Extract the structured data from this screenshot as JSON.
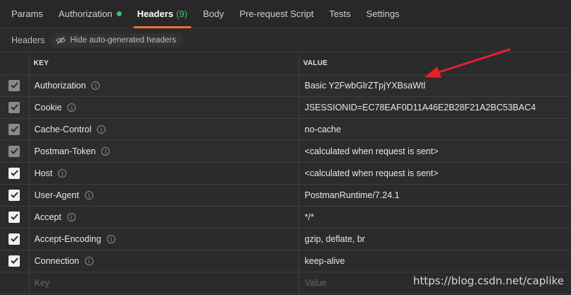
{
  "tabs": [
    {
      "label": "Params"
    },
    {
      "label": "Authorization"
    },
    {
      "label": "Headers",
      "count": "(9)"
    },
    {
      "label": "Body"
    },
    {
      "label": "Pre-request Script"
    },
    {
      "label": "Tests"
    },
    {
      "label": "Settings"
    }
  ],
  "subbar": {
    "label": "Headers",
    "hide_button": "Hide auto-generated headers"
  },
  "table": {
    "columns": {
      "key": "KEY",
      "value": "VALUE"
    },
    "rows": [
      {
        "key": "Authorization",
        "value": "Basic Y2FwbGlrZTpjYXBsaWtl",
        "auto": true
      },
      {
        "key": "Cookie",
        "value": "JSESSIONID=EC78EAF0D11A46E2B28F21A2BC53BAC4",
        "auto": true
      },
      {
        "key": "Cache-Control",
        "value": "no-cache",
        "auto": true
      },
      {
        "key": "Postman-Token",
        "value": "<calculated when request is sent>",
        "auto": true
      },
      {
        "key": "Host",
        "value": "<calculated when request is sent>",
        "auto": false
      },
      {
        "key": "User-Agent",
        "value": "PostmanRuntime/7.24.1",
        "auto": false
      },
      {
        "key": "Accept",
        "value": "*/*",
        "auto": false
      },
      {
        "key": "Accept-Encoding",
        "value": "gzip, deflate, br",
        "auto": false
      },
      {
        "key": "Connection",
        "value": "keep-alive",
        "auto": false
      }
    ],
    "new_row": {
      "key_placeholder": "Key",
      "value_placeholder": "Value"
    }
  },
  "watermark": "https://blog.csdn.net/caplike",
  "colors": {
    "accent": "#f26b3a",
    "active_dot": "#3fbf6f",
    "arrow": "#e8202a"
  }
}
